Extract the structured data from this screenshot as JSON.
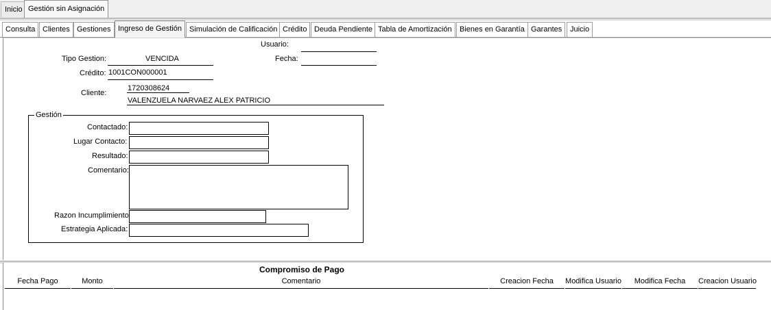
{
  "top_tabs": [
    "Inicio",
    "Gestión sin Asignación"
  ],
  "tabs": [
    "Consulta",
    "Clientes",
    "Gestiones",
    "Ingreso de Gestión",
    "Simulación de Calificación",
    "Crédito",
    "Deuda Pendiente",
    "Tabla de Amortización",
    "Bienes en Garantía",
    "Garantes",
    "Juicio"
  ],
  "header": {
    "usuario_label": "Usuario:",
    "usuario_value": "",
    "fecha_label": "Fecha:",
    "fecha_value": "",
    "tipo_label": "Tipo Gestion:",
    "tipo_value": "VENCIDA",
    "credito_label": "Crédito:",
    "credito_value": "1001CON000001",
    "cliente_label": "Cliente:",
    "cliente_id": "1720308624",
    "cliente_nombre": "VALENZUELA NARVAEZ ALEX PATRICIO"
  },
  "gestion": {
    "legend": "Gestión",
    "contactado_label": "Contactado:",
    "contactado_value": "",
    "lugar_label": "Lugar Contacto:",
    "lugar_value": "",
    "resultado_label": "Resultado:",
    "resultado_value": "",
    "comentario_label": "Comentario:",
    "comentario_value": "",
    "razon_label": "Razon Incumplimiento:",
    "razon_value": "",
    "estrategia_label": "Estrategia Aplicada:",
    "estrategia_value": ""
  },
  "compromiso": {
    "title": "Compromiso de Pago",
    "columns": [
      "Fecha Pago",
      "Monto",
      "Comentario",
      "Creacion Fecha",
      "Modifica Usuario",
      "Modifica Fecha",
      "Creacion Usuario"
    ]
  }
}
